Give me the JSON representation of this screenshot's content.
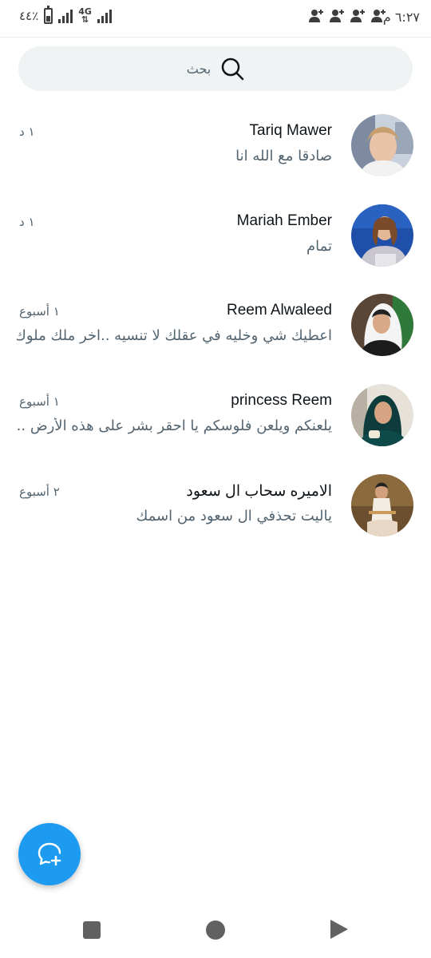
{
  "status_bar": {
    "time": "٦:٢٧ م",
    "battery": "٤٤٪",
    "battery_level": 0.44,
    "network": "4G"
  },
  "search": {
    "placeholder": "بحث",
    "icon": "search-icon"
  },
  "conversations": [
    {
      "name": "Tariq Mawer",
      "time": "١ د",
      "preview": "صادقا مع الله انا"
    },
    {
      "name": "Mariah Ember",
      "time": "١ د",
      "preview": "تمام"
    },
    {
      "name": "Reem Alwaleed",
      "time": "١ أسبوع",
      "preview": "اعطيك شي وخليه في عقلك لا تنسيه ..اخر ملك ملوك..."
    },
    {
      "name": "princess Reem",
      "time": "١ أسبوع",
      "preview": "يلعنكم ويلعن فلوسكم يا احقر بشر على هذه الأرض ....."
    },
    {
      "name": "الاميره سحاب ال سعود",
      "time": "٢ أسبوع",
      "preview": "ياليت تحذفي ال سعود من اسمك"
    }
  ],
  "fab": {
    "icon": "new-message-icon",
    "color": "#1d9bf0"
  },
  "navigation": {
    "icons": [
      "recents-icon",
      "home-icon",
      "back-icon"
    ]
  }
}
